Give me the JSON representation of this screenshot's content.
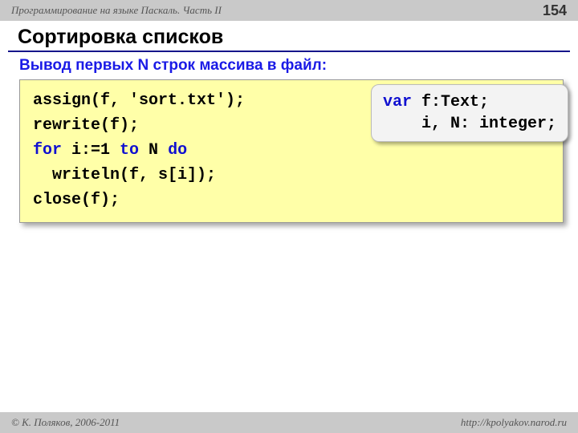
{
  "header": {
    "course": "Программирование на языке Паскаль. Часть II",
    "page": "154"
  },
  "title": "Сортировка списков",
  "subtitle": "Вывод первых N строк массива в файл:",
  "code": {
    "l1": "assign(f, 'sort.txt');",
    "l2": "rewrite(f);",
    "l3a": "for",
    "l3b": " i:=1 ",
    "l3c": "to",
    "l3d": " N ",
    "l3e": "do",
    "l4": "  writeln(f, s[i]);",
    "l5": "close(f);"
  },
  "varbox": {
    "kw": "var",
    "l1": " f:Text;",
    "l2": "    i, N: integer;"
  },
  "footer": {
    "copyright": "© К. Поляков, 2006-2011",
    "url": "http://kpolyakov.narod.ru"
  }
}
